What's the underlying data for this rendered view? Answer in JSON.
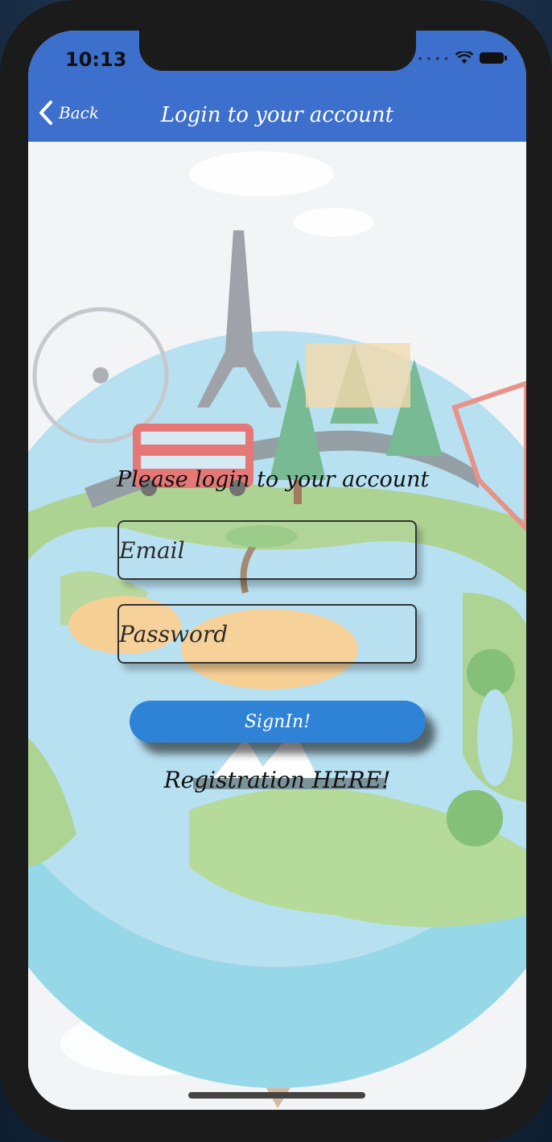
{
  "status_bar": {
    "time": "10:13"
  },
  "nav": {
    "back_label": "Back",
    "title": "Login to your account"
  },
  "form": {
    "prompt": "Please login to your account",
    "email_placeholder": "Email",
    "password_placeholder": "Password",
    "signin_label": "SignIn!",
    "register_label": "Registration HERE!"
  },
  "colors": {
    "accent": "#3d6fcc",
    "button": "#2f83d6"
  },
  "icons": {
    "back": "chevron-left-icon",
    "wifi": "wifi-icon",
    "battery": "battery-icon"
  }
}
